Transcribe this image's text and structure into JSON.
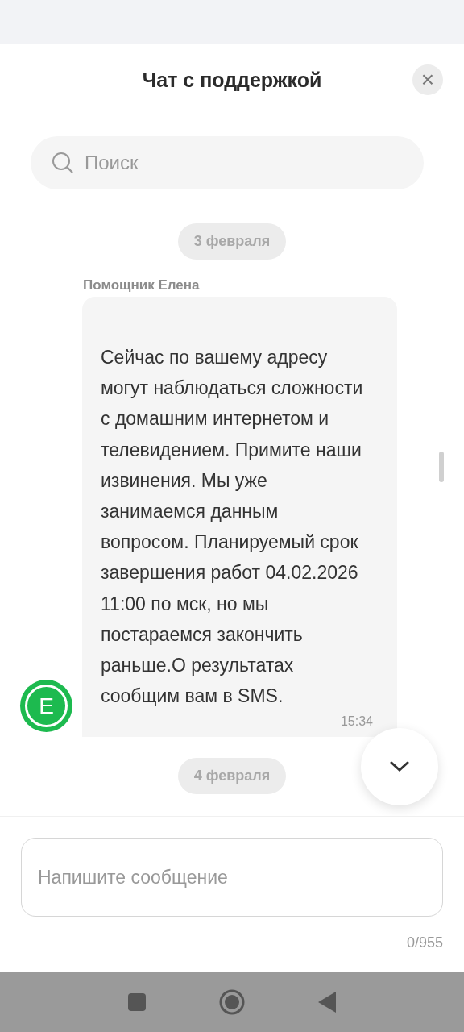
{
  "header": {
    "title": "Чат с поддержкой",
    "close": "×"
  },
  "search": {
    "placeholder": "Поиск"
  },
  "messages": [
    {
      "kind": "date",
      "text": "3 февраля"
    },
    {
      "kind": "incoming",
      "sender": "Помощник Елена",
      "avatar": "Е",
      "text": "Сейчас по вашему адресу могут наблюдаться сложности с домашним интернетом и телевидением. Примите наши извинения. Мы уже занимаемся данным вопросом. Планируемый срок завершения работ 04.02.2026 11:00 по мск, но мы постараемся закончить раньше.О результатах сообщим вам в SMS.",
      "time": "15:34"
    },
    {
      "kind": "date",
      "text": "4 февраля"
    }
  ],
  "composer": {
    "placeholder": "Напишите сообщение",
    "counter": "0/955"
  }
}
